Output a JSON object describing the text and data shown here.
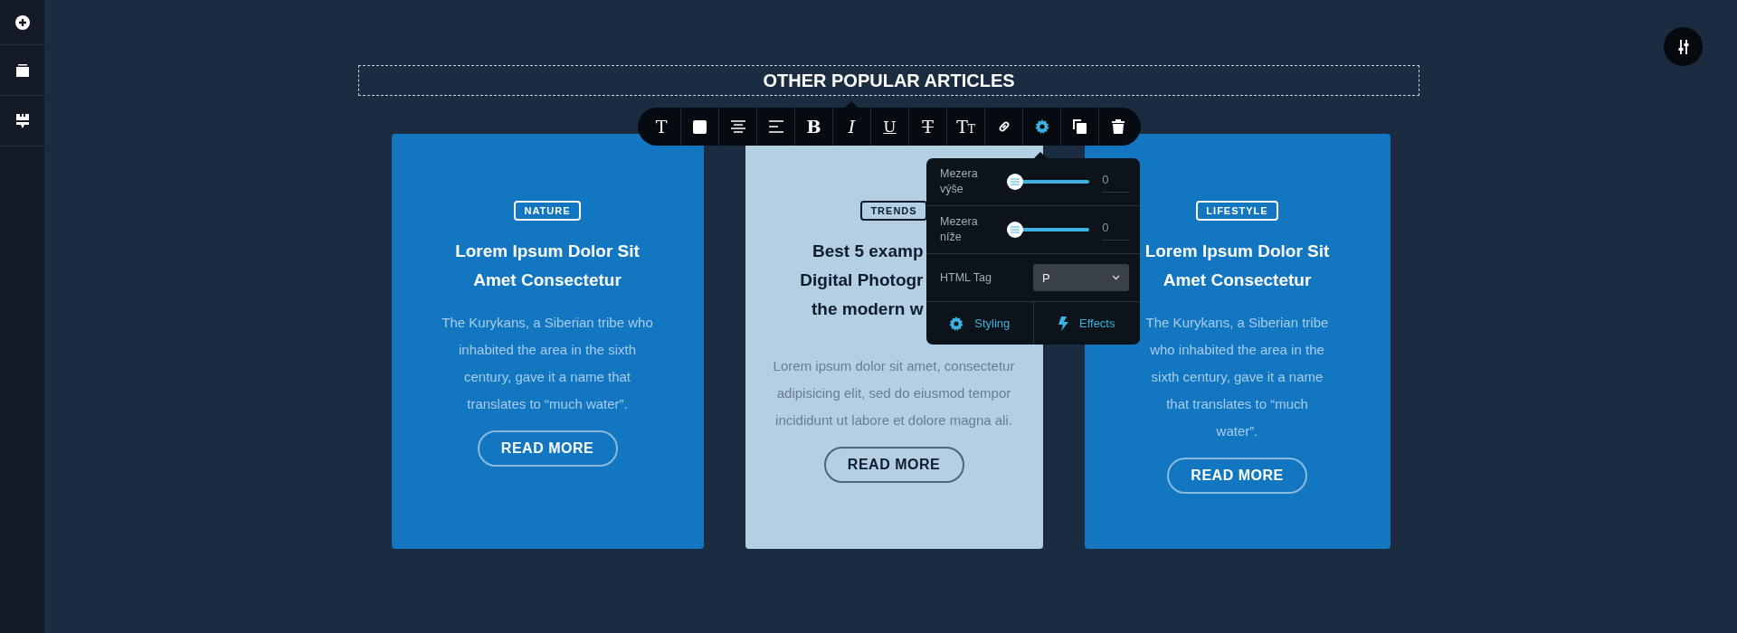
{
  "heading": {
    "text": "OTHER POPULAR ARTICLES"
  },
  "toolbar": {
    "buttons": [
      {
        "kind": "text",
        "glyph": "T",
        "selected": false
      },
      {
        "kind": "color",
        "selected": false
      },
      {
        "kind": "align-center",
        "selected": false
      },
      {
        "kind": "align-left",
        "selected": false
      },
      {
        "kind": "bold",
        "glyph": "B",
        "selected": false
      },
      {
        "kind": "italic",
        "glyph": "I",
        "selected": false
      },
      {
        "kind": "underline",
        "glyph": "U",
        "selected": false
      },
      {
        "kind": "strike",
        "glyph": "T",
        "selected": false
      },
      {
        "kind": "font-size",
        "glyph": "TT",
        "selected": false
      },
      {
        "kind": "link",
        "selected": false
      },
      {
        "kind": "settings",
        "selected": true
      },
      {
        "kind": "duplicate",
        "selected": false
      },
      {
        "kind": "delete",
        "selected": false
      }
    ]
  },
  "cards": [
    {
      "selected": false,
      "tag": "NATURE",
      "title": [
        "Lorem Ipsum Dolor Sit",
        "Amet Consectetur"
      ],
      "body": "The Kurykans, a Siberian tribe who inhabited the area in the sixth century, gave it a name that translates to “much water”.",
      "button": "READ MORE"
    },
    {
      "selected": true,
      "tag": "TRENDS",
      "title": [
        "Best 5 examp",
        "Digital Photogr",
        "the modern w"
      ],
      "body": "Lorem ipsum dolor sit amet, consectetur adipisicing elit, sed do eiusmod tempor incididunt ut labore et dolore magna ali.",
      "button": "READ MORE"
    },
    {
      "selected": false,
      "tag": "LIFESTYLE",
      "title": [
        "Lorem Ipsum Dolor Sit",
        "Amet Consectetur"
      ],
      "body": "The Kurykans, a Siberian tribe who inhabited the area in the sixth century, gave it a name that translates to “much water”.",
      "button": "READ MORE"
    }
  ],
  "settings_popup": {
    "rows": [
      {
        "kind": "slider",
        "label": "Mezera výše",
        "level": 0,
        "value": "0"
      },
      {
        "kind": "slider",
        "label": "Mezera níže",
        "level": 0,
        "value": "0"
      },
      {
        "kind": "select",
        "label": "HTML Tag",
        "value": "P"
      }
    ],
    "tabs": [
      {
        "kind": "styling",
        "label": "Styling"
      },
      {
        "kind": "effects",
        "label": "Effects"
      }
    ]
  }
}
